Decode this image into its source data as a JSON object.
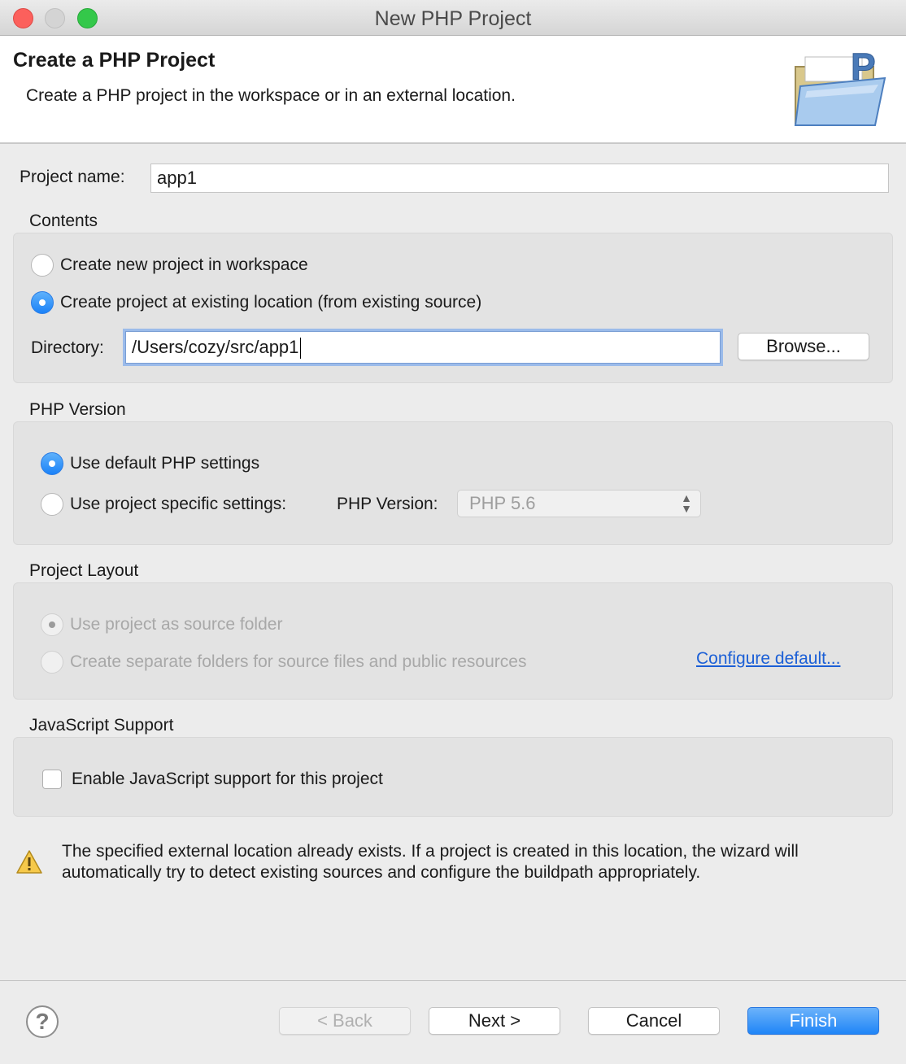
{
  "window": {
    "title": "New PHP Project"
  },
  "header": {
    "title": "Create a PHP Project",
    "description": "Create a PHP project in the workspace or in an external location.",
    "icon": "php-folder-icon"
  },
  "project_name": {
    "label": "Project name:",
    "value": "app1"
  },
  "contents": {
    "label": "Contents",
    "options": [
      {
        "label": "Create new project in workspace",
        "selected": false
      },
      {
        "label": "Create project at existing location (from existing source)",
        "selected": true
      }
    ],
    "directory_label": "Directory:",
    "directory_value": "/Users/cozy/src/app1",
    "browse_label": "Browse..."
  },
  "php_version": {
    "label": "PHP Version",
    "options": [
      {
        "label": "Use default PHP settings",
        "selected": true
      },
      {
        "label": "Use project specific settings:",
        "selected": false
      }
    ],
    "version_label": "PHP Version:",
    "version_value": "PHP 5.6"
  },
  "project_layout": {
    "label": "Project Layout",
    "options": [
      {
        "label": "Use project as source folder",
        "selected": true,
        "enabled": false
      },
      {
        "label": "Create separate folders for source files and public resources",
        "selected": false,
        "enabled": false
      }
    ],
    "configure_link": "Configure default..."
  },
  "javascript_support": {
    "label": "JavaScript Support",
    "checkbox_label": "Enable JavaScript support for this project",
    "checked": false
  },
  "warning": {
    "icon": "warning-icon",
    "text": "The specified external location already exists. If a project is created in this location, the wizard will automatically try to detect existing sources and configure the buildpath appropriately."
  },
  "footer": {
    "help_icon": "help-icon",
    "back_label": "< Back",
    "next_label": "Next >",
    "cancel_label": "Cancel",
    "finish_label": "Finish"
  },
  "colors": {
    "accent": "#1f85f7",
    "link": "#1b5fd6",
    "close": "#fc605c",
    "maximize": "#34c84a"
  }
}
